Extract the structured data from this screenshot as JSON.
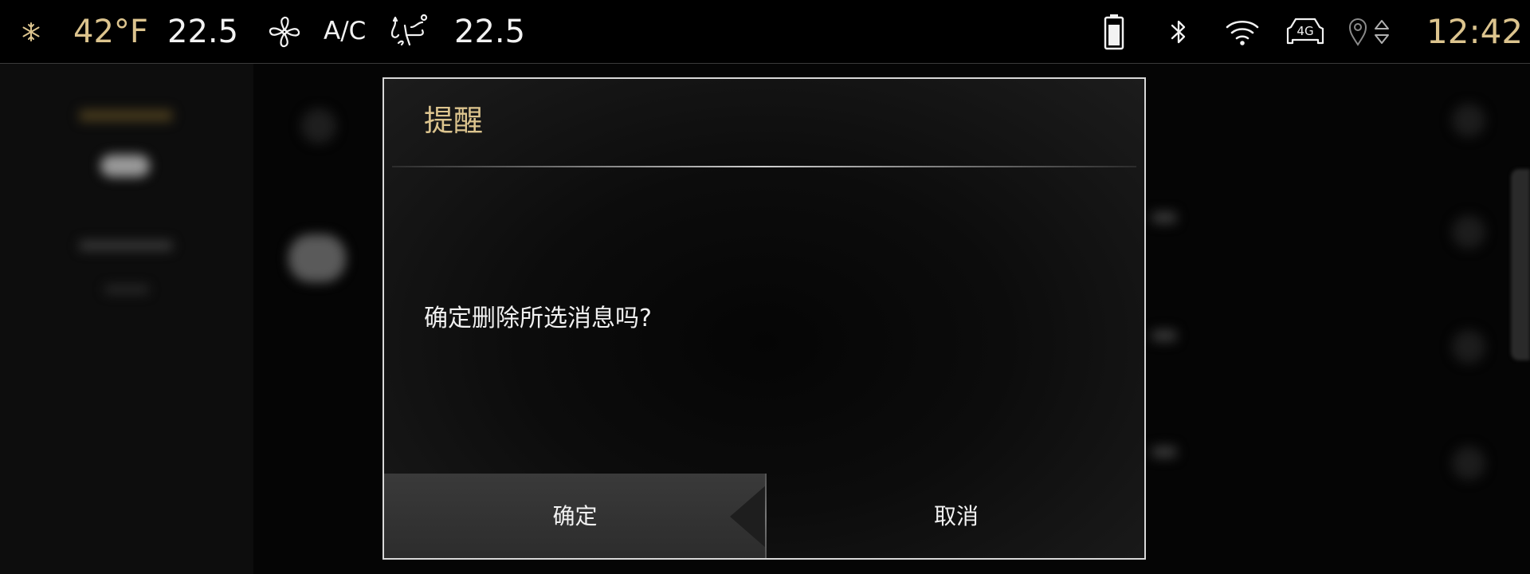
{
  "status_bar": {
    "fan_icon": "snowflake-icon",
    "outside_temp": "42°F",
    "left_temp": "22.5",
    "fan_speed_icon": "fan-icon",
    "ac_label": "A/C",
    "air_flow_icon": "seat-airflow-icon",
    "right_temp": "22.5",
    "battery_icon": "battery-icon",
    "bluetooth_icon": "bluetooth-icon",
    "wifi_icon": "wifi-icon",
    "network_label": "4G",
    "location_icon": "location-pin-icon",
    "time": "12:42"
  },
  "dialog": {
    "title": "提醒",
    "message": "确定删除所选消息吗?",
    "confirm_label": "确定",
    "cancel_label": "取消"
  },
  "colors": {
    "accent_gold": "#dcc48e",
    "text_white": "#f2f2f2",
    "background": "#050505"
  }
}
